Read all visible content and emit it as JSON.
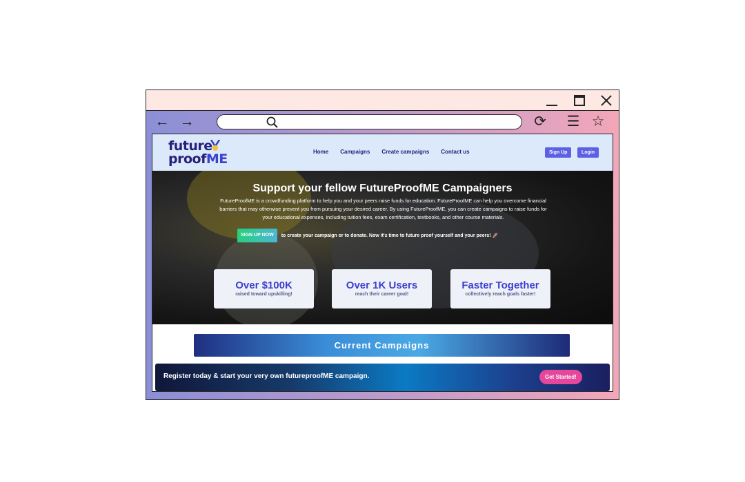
{
  "window": {
    "controls": {
      "minimize_icon": "minimize-icon",
      "maximize_icon": "maximize-icon",
      "close_icon": "close-icon"
    }
  },
  "browser_toolbar": {
    "icons": [
      "back-arrow-icon",
      "forward-arrow-icon",
      "search-icon",
      "reload-icon",
      "menu-icon",
      "star-icon"
    ],
    "address_value": ""
  },
  "site": {
    "logo": {
      "line1": "future",
      "line2_prefix": "proof",
      "line2_suffix": "ME"
    },
    "nav": [
      "Home",
      "Campaigns",
      "Create campaigns",
      "Contact us"
    ],
    "signup_label": "Sign Up",
    "login_label": "Login"
  },
  "hero": {
    "title": "Support your fellow FutureProofME Campaigners",
    "description": "FutureProofME is a crowdfunding platform to help you and your peers raise funds for education. FutureProofME can help you overcome financial barriers that may otherwise prevent you from pursuing your desired career. By using FutureProofME, you can create campaigns to raise funds for your educational expenses, including tuition fees, exam certification, textbooks, and other course materials.",
    "cta_button": "SIGN UP NOW",
    "cta_text": "to create your campaign or to donate. Now it's time to future proof yourself and your peers! 🚀"
  },
  "stats": [
    {
      "value": "Over $100K",
      "label": "raised toward upskilling!"
    },
    {
      "value": "Over 1K Users",
      "label": "reach their career goal!"
    },
    {
      "value": "Faster Together",
      "label": "collectively reach goals faster!"
    }
  ],
  "current_campaigns_label": "Current Campaigns",
  "banner": {
    "text": "Register today & start your very own futureproofME campaign.",
    "button": "Get Started!"
  },
  "colors": {
    "brand_dark": "#27207b",
    "brand_accent": "#3a43c9",
    "button_primary": "#5d5fe4",
    "cta_pink": "#e5489a"
  }
}
